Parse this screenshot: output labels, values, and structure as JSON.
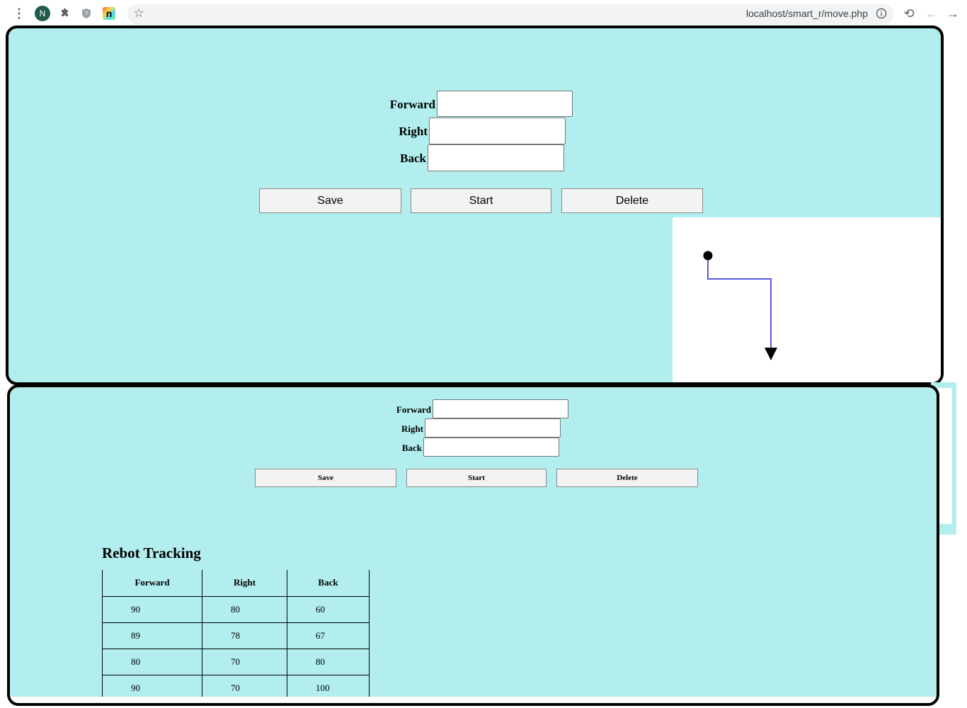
{
  "browser": {
    "avatar_letter": "N",
    "extension_label": "n",
    "url": "localhost/smart_r/move.php"
  },
  "panel1": {
    "fields": [
      {
        "label": "Forward",
        "value": ""
      },
      {
        "label": "Right",
        "value": ""
      },
      {
        "label": "Back",
        "value": ""
      }
    ],
    "buttons": {
      "save": "Save",
      "start": "Start",
      "delete": "Delete"
    },
    "path_colors": {
      "line": "#5b5bd9",
      "marker": "#000000"
    }
  },
  "panel2": {
    "fields": [
      {
        "label": "Forward",
        "value": ""
      },
      {
        "label": "Right",
        "value": ""
      },
      {
        "label": "Back",
        "value": ""
      }
    ],
    "buttons": {
      "save": "Save",
      "start": "Start",
      "delete": "Delete"
    },
    "tracking": {
      "title": "Rebot Tracking",
      "columns": [
        "Forward",
        "Right",
        "Back"
      ],
      "rows": [
        [
          "90",
          "80",
          "60"
        ],
        [
          "89",
          "78",
          "67"
        ],
        [
          "80",
          "70",
          "80"
        ],
        [
          "90",
          "70",
          "100"
        ]
      ]
    }
  },
  "colors": {
    "panel_bg": "#b2eeed",
    "border": "#000000"
  }
}
